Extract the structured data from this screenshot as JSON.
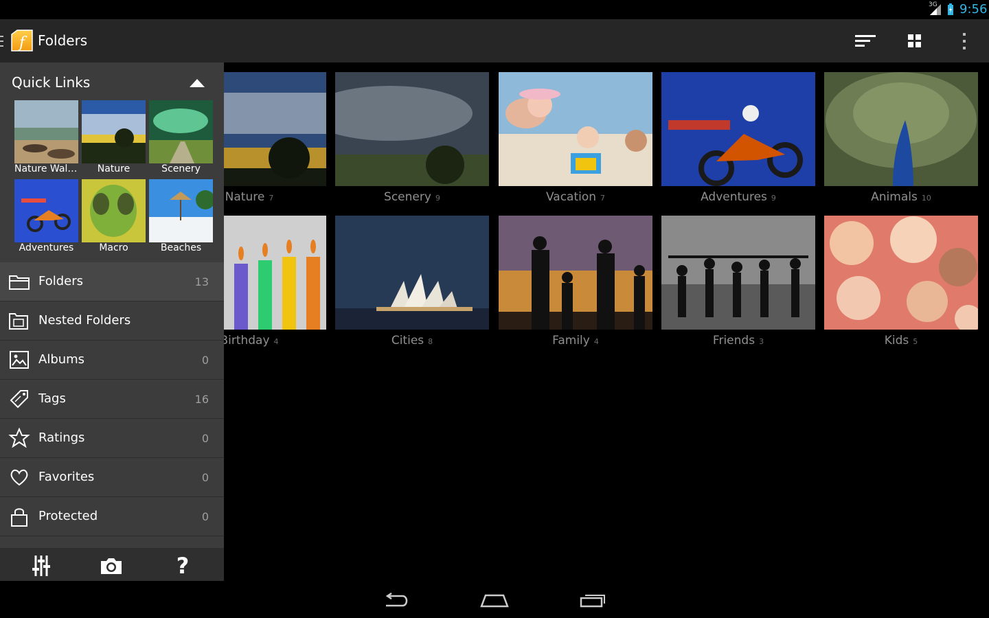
{
  "status_bar": {
    "network": "3G",
    "time": "9:56",
    "accent_color": "#33b5e5"
  },
  "action_bar": {
    "title": "Folders",
    "icons": [
      "drawer-indicator-icon",
      "app-logo-icon",
      "sort-icon",
      "grid-view-icon",
      "overflow-menu-icon"
    ]
  },
  "quick_links": {
    "title": "Quick Links",
    "items": [
      {
        "label": "Nature Wall..."
      },
      {
        "label": "Nature"
      },
      {
        "label": "Scenery"
      },
      {
        "label": "Adventures"
      },
      {
        "label": "Macro"
      },
      {
        "label": "Beaches"
      }
    ]
  },
  "nav": {
    "items": [
      {
        "label": "Folders",
        "count": "13",
        "icon": "folder-icon",
        "selected": true
      },
      {
        "label": "Nested Folders",
        "count": "",
        "icon": "nested-folder-icon"
      },
      {
        "label": "Albums",
        "count": "0",
        "icon": "album-icon"
      },
      {
        "label": "Tags",
        "count": "16",
        "icon": "tag-icon"
      },
      {
        "label": "Ratings",
        "count": "0",
        "icon": "star-icon"
      },
      {
        "label": "Favorites",
        "count": "0",
        "icon": "heart-icon"
      },
      {
        "label": "Protected",
        "count": "0",
        "icon": "lock-icon"
      }
    ]
  },
  "drawer_footer": {
    "icons": [
      "settings-sliders-icon",
      "camera-icon",
      "help-icon"
    ],
    "help_glyph": "?"
  },
  "folders": [
    {
      "name": "Nature",
      "count": "7"
    },
    {
      "name": "Scenery",
      "count": "9"
    },
    {
      "name": "Vacation",
      "count": "7"
    },
    {
      "name": "Adventures",
      "count": "9"
    },
    {
      "name": "Animals",
      "count": "10"
    },
    {
      "name": "Birthday",
      "count": "4"
    },
    {
      "name": "Cities",
      "count": "8"
    },
    {
      "name": "Family",
      "count": "4"
    },
    {
      "name": "Friends",
      "count": "3"
    },
    {
      "name": "Kids",
      "count": "5"
    }
  ],
  "nav_bar": {
    "icons": [
      "back-icon",
      "home-icon",
      "recent-apps-icon"
    ]
  }
}
